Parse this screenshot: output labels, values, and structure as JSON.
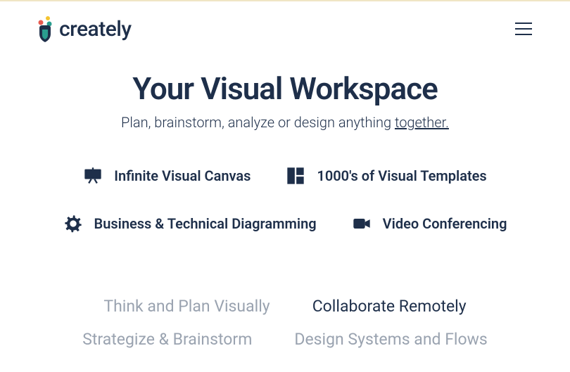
{
  "header": {
    "brand": "creately"
  },
  "hero": {
    "title": "Your Visual Workspace",
    "subtitle_prefix": "Plan, brainstorm, analyze or design anything ",
    "subtitle_link": "together."
  },
  "features": [
    {
      "icon": "presentation-icon",
      "label": "Infinite Visual Canvas"
    },
    {
      "icon": "templates-icon",
      "label": "1000's of Visual Templates"
    },
    {
      "icon": "gear-icon",
      "label": "Business & Technical Diagramming"
    },
    {
      "icon": "video-icon",
      "label": "Video Conferencing"
    }
  ],
  "tabs": [
    {
      "label": "Think and Plan Visually",
      "active": false
    },
    {
      "label": "Collaborate Remotely",
      "active": true
    },
    {
      "label": "Strategize & Brainstorm",
      "active": false
    },
    {
      "label": "Design Systems and Flows",
      "active": false
    }
  ]
}
